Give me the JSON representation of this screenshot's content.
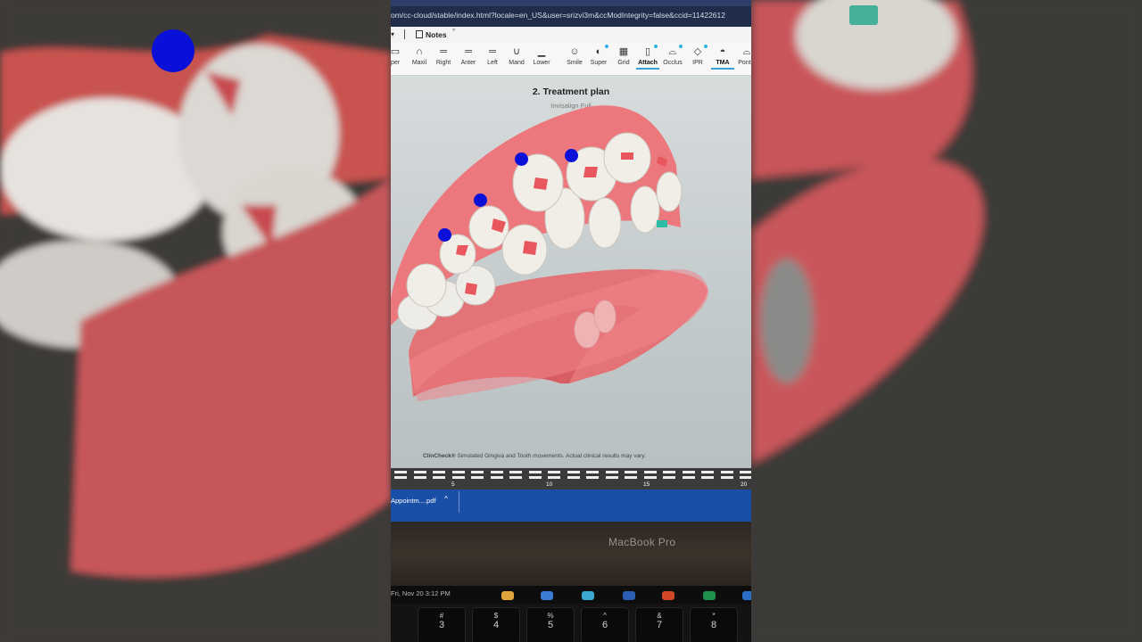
{
  "browser": {
    "url": "om/cc-cloud/stable/index.html?locale=en_US&user=srizvi3m&ccModIntegrity=false&ccid=11422612",
    "tab_dropdown": "▾",
    "notes_label": "Notes",
    "notes_dot": "°"
  },
  "toolbar": {
    "items": [
      {
        "label": "per",
        "icon": "upper-icon"
      },
      {
        "label": "Maxil",
        "icon": "maxillary-icon"
      },
      {
        "label": "Right",
        "icon": "right-view-icon"
      },
      {
        "label": "Anter",
        "icon": "anterior-view-icon"
      },
      {
        "label": "Left",
        "icon": "left-view-icon"
      },
      {
        "label": "Mand",
        "icon": "mandibular-icon"
      },
      {
        "label": "Lower",
        "icon": "lower-icon"
      },
      {
        "label": "Smile",
        "icon": "smile-icon"
      },
      {
        "label": "Super",
        "icon": "superimpose-icon"
      },
      {
        "label": "Grid",
        "icon": "grid-icon"
      },
      {
        "label": "Attach",
        "icon": "attachment-icon",
        "active": true
      },
      {
        "label": "Occlus",
        "icon": "occlusion-icon"
      },
      {
        "label": "IPR",
        "icon": "ipr-icon"
      },
      {
        "label": "TMA",
        "icon": "tma-icon",
        "active": true
      },
      {
        "label": "Pontic",
        "icon": "pontic-icon"
      }
    ]
  },
  "viewport": {
    "title": "2. Treatment plan",
    "subtitle": "Invisalign Full",
    "disclaimer_brand": "ClinCheck®",
    "disclaimer_text": " Simulated Gingiva and Tooth movements. Actual clinical results may vary."
  },
  "timeline": {
    "labels": [
      "5",
      "10",
      "15",
      "20"
    ]
  },
  "downloads": {
    "item": "Appointm....pdf",
    "chevron": "^"
  },
  "laptop": {
    "brand": "MacBook Pro",
    "touchbar_date": "Fri, Nov 20  3:12 PM",
    "keys": [
      {
        "top": "#",
        "bottom": "3"
      },
      {
        "top": "$",
        "bottom": "4"
      },
      {
        "top": "%",
        "bottom": "5"
      },
      {
        "top": "^",
        "bottom": "6"
      },
      {
        "top": "&",
        "bottom": "7"
      },
      {
        "top": "*",
        "bottom": "8"
      }
    ]
  },
  "colors": {
    "marker_blue": "#0a10d8",
    "gum_pink": "#e8646a",
    "download_bar": "#1a4fa8",
    "accent_teal": "#3aa0d8"
  }
}
